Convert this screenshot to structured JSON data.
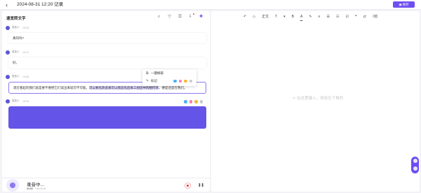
{
  "header": {
    "back_icon": "chevron-left-icon",
    "title": "2024-08-31 12:20 记录",
    "save_label": "保存"
  },
  "left_panel": {
    "title": "速览转文字",
    "tools": [
      "search-icon",
      "filter-icon",
      "list-icon",
      "export-icon",
      "ai-icon"
    ],
    "messages": [
      {
        "speaker": "发言人",
        "time": "00:10",
        "text": "真的吗?"
      },
      {
        "speaker": "发言人",
        "time": "01:41",
        "text": "好。"
      },
      {
        "speaker": "发言人",
        "time": "01:50",
        "text_before": "现在看起的我们就是要不要把它们读出来就可不可能。",
        "text_highlight": "可以要先改变来可以我首先后来工想后中的相行享",
        "text_after": "，便是还是在我们。"
      },
      {
        "speaker": "发言人",
        "time": "01:54",
        "text": ""
      }
    ],
    "highlight_colors": [
      "#4fb2f5",
      "#f47fae",
      "#f5b93a",
      "#c9c9c9"
    ]
  },
  "popup": {
    "items": [
      {
        "icon": "copy-icon",
        "label": "一键摘取"
      },
      {
        "icon": "pen-icon",
        "label": "标记"
      }
    ],
    "colors": [
      "#4fb2f5",
      "#f47fae",
      "#f5b93a",
      "#c9c9c9"
    ]
  },
  "recording": {
    "title": "录音中...",
    "current": "00:59",
    "total": "/ 00:01:00"
  },
  "editor": {
    "tools": [
      "↶",
      "◇",
      "正文",
      "T",
      "▾",
      "B",
      "A",
      "✎",
      "≡",
      "☰",
      "☷",
      "☑",
      "❝",
      "⇄",
      "⌫"
    ],
    "placeholder": "✍ 在这里输入，体验左下角的"
  },
  "colors": {
    "accent": "#6d4ef2",
    "highlight_bg": "#d9d3ff"
  }
}
